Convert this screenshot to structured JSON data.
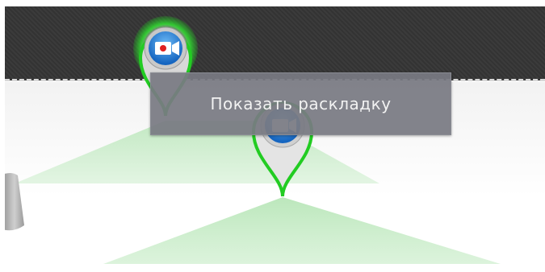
{
  "context_menu": {
    "items": [
      {
        "label": "Показать раскладку"
      }
    ]
  },
  "cameras": [
    {
      "id": "camera-1",
      "icon": "video-camera-icon",
      "state": "active",
      "highlight_color": "#22cc22",
      "icon_color": "#1f7fd6",
      "record_indicator": "#e02020"
    },
    {
      "id": "camera-2",
      "icon": "video-camera-icon",
      "state": "normal",
      "highlight_color": "#22cc22",
      "icon_color": "#1f7fd6"
    }
  ],
  "colors": {
    "wall": "#363636",
    "floor": "#f2f2f2",
    "view_cone": "#bfe8bf",
    "menu_background": "#787a82",
    "menu_text": "#f2f2f2"
  }
}
